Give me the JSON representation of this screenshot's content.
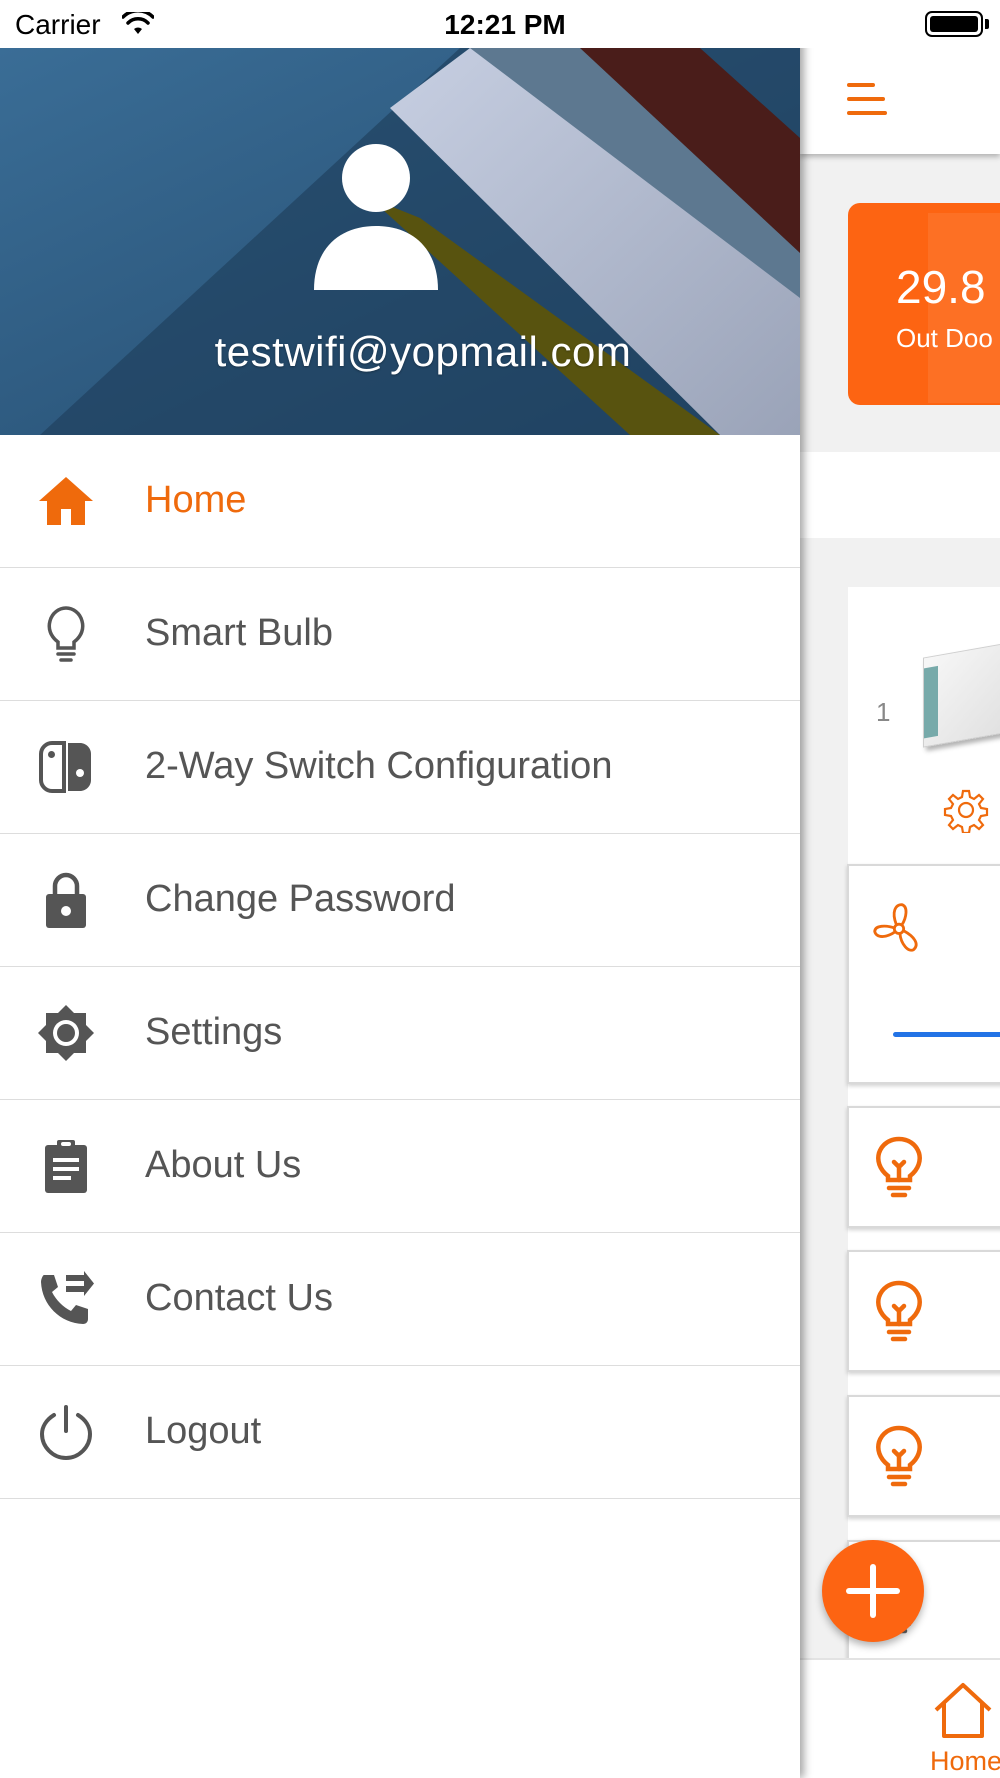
{
  "status_bar": {
    "carrier": "Carrier",
    "time": "12:21 PM"
  },
  "drawer": {
    "user_email": "testwifi@yopmail.com",
    "active_item": "Home",
    "items": [
      {
        "label": "Home",
        "icon": "home-icon"
      },
      {
        "label": "Smart Bulb",
        "icon": "bulb-icon"
      },
      {
        "label": "2-Way Switch Configuration",
        "icon": "switch-icon"
      },
      {
        "label": "Change Password",
        "icon": "lock-icon"
      },
      {
        "label": "Settings",
        "icon": "brightness-icon"
      },
      {
        "label": "About Us",
        "icon": "clipboard-icon"
      },
      {
        "label": "Contact Us",
        "icon": "phone-forward-icon"
      },
      {
        "label": "Logout",
        "icon": "power-icon"
      }
    ]
  },
  "main": {
    "weather": {
      "temperature": "29.8",
      "label": "Out Doo"
    },
    "device": {
      "index": "1"
    },
    "tabbar": {
      "home_label": "Home"
    }
  },
  "colors": {
    "accent": "#ef6a0c",
    "card_orange": "#fd6412",
    "menu_text": "#555555",
    "header_blue": "#2d5b82",
    "slider_blue": "#2273e6"
  }
}
